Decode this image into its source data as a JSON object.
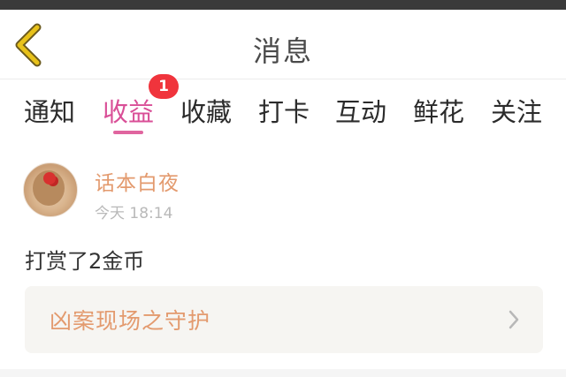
{
  "header": {
    "title": "消息",
    "back_icon": "chevron-left-icon"
  },
  "tabs": [
    {
      "label": "通知",
      "active": false
    },
    {
      "label": "收益",
      "active": true,
      "badge": "1"
    },
    {
      "label": "收藏",
      "active": false
    },
    {
      "label": "打卡",
      "active": false
    },
    {
      "label": "互动",
      "active": false
    },
    {
      "label": "鲜花",
      "active": false
    },
    {
      "label": "关注",
      "active": false
    }
  ],
  "message": {
    "sender": "话本白夜",
    "time": "今天 18:14",
    "text": "打赏了2金币",
    "work_title": "凶案现场之守护"
  },
  "colors": {
    "accent_pink": "#d94f97",
    "badge_red": "#f0343c",
    "name_orange": "#e39a6e",
    "back_arrow": "#e8c21a"
  }
}
